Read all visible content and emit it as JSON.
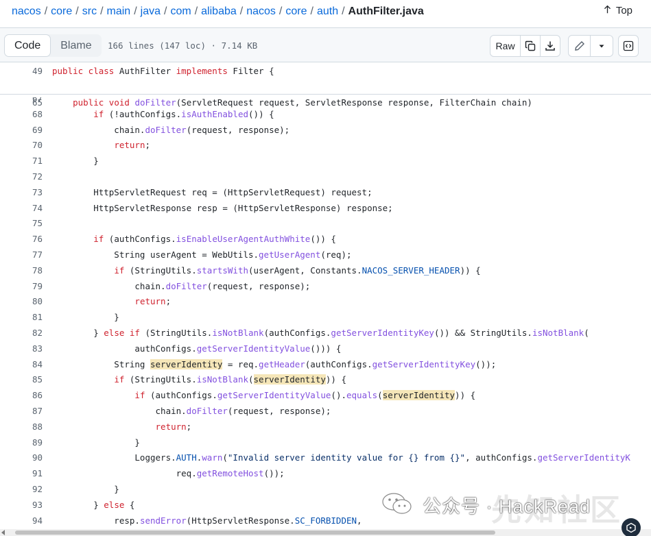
{
  "breadcrumb": {
    "parts": [
      "nacos",
      "core",
      "src",
      "main",
      "java",
      "com",
      "alibaba",
      "nacos",
      "core",
      "auth"
    ],
    "file": "AuthFilter.java",
    "top_label": "Top"
  },
  "toolbar": {
    "code_tab": "Code",
    "blame_tab": "Blame",
    "meta": "166 lines (147 loc) · 7.14 KB",
    "raw_label": "Raw"
  },
  "sticky_lines": [
    {
      "n": "49",
      "html": "<span class=\"kw\">public class</span> AuthFilter <span class=\"kw\">implements</span> Filter {"
    },
    {
      "n": "65",
      "html": "    <span class=\"kw\">public void</span> <span class=\"fn\">doFilter</span>(ServletRequest request, ServletResponse response, FilterChain chain)"
    }
  ],
  "code_lines": [
    {
      "n": "67",
      "html": ""
    },
    {
      "n": "68",
      "html": "        <span class=\"kw\">if</span> (!authConfigs.<span class=\"fn\">isAuthEnabled</span>()) {"
    },
    {
      "n": "69",
      "html": "            chain.<span class=\"fn\">doFilter</span>(request, response);"
    },
    {
      "n": "70",
      "html": "            <span class=\"kw\">return</span>;"
    },
    {
      "n": "71",
      "html": "        }"
    },
    {
      "n": "72",
      "html": ""
    },
    {
      "n": "73",
      "html": "        HttpServletRequest req = (HttpServletRequest) request;"
    },
    {
      "n": "74",
      "html": "        HttpServletResponse resp = (HttpServletResponse) response;"
    },
    {
      "n": "75",
      "html": ""
    },
    {
      "n": "76",
      "html": "        <span class=\"kw\">if</span> (authConfigs.<span class=\"fn\">isEnableUserAgentAuthWhite</span>()) {"
    },
    {
      "n": "77",
      "html": "            String userAgent = WebUtils.<span class=\"fn\">getUserAgent</span>(req);"
    },
    {
      "n": "78",
      "html": "            <span class=\"kw\">if</span> (StringUtils.<span class=\"fn\">startsWith</span>(userAgent, Constants.<span class=\"cn\">NACOS_SERVER_HEADER</span>)) {"
    },
    {
      "n": "79",
      "html": "                chain.<span class=\"fn\">doFilter</span>(request, response);"
    },
    {
      "n": "80",
      "html": "                <span class=\"kw\">return</span>;"
    },
    {
      "n": "81",
      "html": "            }"
    },
    {
      "n": "82",
      "html": "        } <span class=\"kw\">else if</span> (StringUtils.<span class=\"fn\">isNotBlank</span>(authConfigs.<span class=\"fn\">getServerIdentityKey</span>()) &amp;&amp; StringUtils.<span class=\"fn\">isNotBlank</span>("
    },
    {
      "n": "83",
      "html": "                authConfigs.<span class=\"fn\">getServerIdentityValue</span>())) {"
    },
    {
      "n": "84",
      "html": "            String <span class=\"hl\">serverIdentity</span> = req.<span class=\"fn\">getHeader</span>(authConfigs.<span class=\"fn\">getServerIdentityKey</span>());"
    },
    {
      "n": "85",
      "html": "            <span class=\"kw\">if</span> (StringUtils.<span class=\"fn\">isNotBlank</span>(<span class=\"hl\">serverIdentity</span>)) {"
    },
    {
      "n": "86",
      "html": "                <span class=\"kw\">if</span> (authConfigs.<span class=\"fn\">getServerIdentityValue</span>().<span class=\"fn\">equals</span>(<span class=\"hl\">serverIdentity</span>)) {"
    },
    {
      "n": "87",
      "html": "                    chain.<span class=\"fn\">doFilter</span>(request, response);"
    },
    {
      "n": "88",
      "html": "                    <span class=\"kw\">return</span>;"
    },
    {
      "n": "89",
      "html": "                }"
    },
    {
      "n": "90",
      "html": "                Loggers.<span class=\"cn\">AUTH</span>.<span class=\"fn\">warn</span>(<span class=\"st\">\"Invalid server identity value for {} from {}\"</span>, authConfigs.<span class=\"fn\">getServerIdentityK</span>"
    },
    {
      "n": "91",
      "html": "                        req.<span class=\"fn\">getRemoteHost</span>());"
    },
    {
      "n": "92",
      "html": "            }"
    },
    {
      "n": "93",
      "html": "        } <span class=\"kw\">else</span> {"
    },
    {
      "n": "94",
      "html": "            resp.<span class=\"fn\">sendError</span>(HttpServletResponse.<span class=\"cn\">SC_FORBIDDEN</span>,"
    }
  ],
  "watermark": {
    "text": "公众号 · HackRead",
    "big": "先知社区"
  },
  "colors": {
    "link": "#0969da",
    "keyword": "#cf222e",
    "function": "#8250df",
    "constant": "#0550ae",
    "highlight": "#f5e6b8"
  },
  "icons": [
    "arrow-up-icon",
    "copy-icon",
    "download-icon",
    "pencil-icon",
    "triangle-down-icon",
    "symbols-icon"
  ]
}
